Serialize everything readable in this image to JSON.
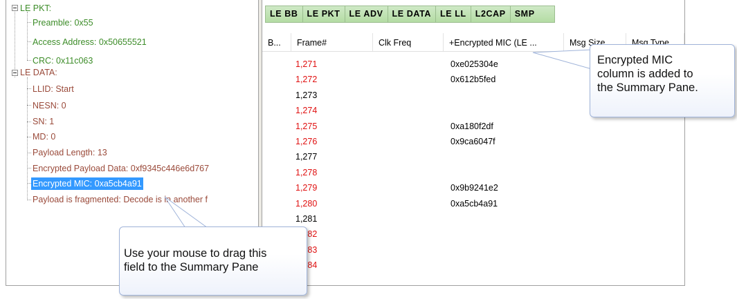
{
  "tree": {
    "le_pkt": {
      "label": "LE PKT:",
      "children": [
        "Preamble: 0x55",
        "Access Address: 0x50655521",
        "CRC: 0x11c063"
      ]
    },
    "le_data": {
      "label": "LE DATA:",
      "children": [
        "LLID: Start",
        "NESN: 0",
        "SN: 1",
        "MD: 0",
        "Payload Length: 13",
        "Encrypted Payload Data: 0xf9345c446e6d767",
        "Encrypted MIC: 0xa5cb4a91",
        "Payload is fragmented: Decode is in another f"
      ]
    }
  },
  "tabs": [
    "LE BB",
    "LE PKT",
    "LE ADV",
    "LE DATA",
    "LE LL",
    "L2CAP",
    "SMP"
  ],
  "columns": [
    "B...",
    "Frame#",
    "Clk Freq",
    "+Encrypted MIC (LE ...",
    "Msg Size",
    "Msg Type"
  ],
  "rows": [
    {
      "frame": "1,271",
      "mic": "0xe025304e",
      "color": "#e01010"
    },
    {
      "frame": "1,272",
      "mic": "0x612b5fed",
      "color": "#e01010"
    },
    {
      "frame": "1,273",
      "mic": "",
      "color": "#000000"
    },
    {
      "frame": "1,274",
      "mic": "",
      "color": "#e01010"
    },
    {
      "frame": "1,275",
      "mic": "0xa180f2df",
      "color": "#e01010"
    },
    {
      "frame": "1,276",
      "mic": "0x9ca6047f",
      "color": "#e01010"
    },
    {
      "frame": "1,277",
      "mic": "",
      "color": "#000000"
    },
    {
      "frame": "1,278",
      "mic": "",
      "color": "#e01010"
    },
    {
      "frame": "1,279",
      "mic": "0x9b9241e2",
      "color": "#e01010"
    },
    {
      "frame": "1,280",
      "mic": "0xa5cb4a91",
      "color": "#e01010"
    },
    {
      "frame": "1,281",
      "mic": "",
      "color": "#000000"
    },
    {
      "frame": "1,282",
      "mic": "",
      "color": "#e01010"
    },
    {
      "frame": "1,283",
      "mic": "",
      "color": "#e01010"
    },
    {
      "frame": "1,284",
      "mic": "",
      "color": "#e01010"
    }
  ],
  "callouts": {
    "summary_note": [
      "Encrypted MIC",
      "column is added to",
      "the Summary Pane."
    ],
    "drag_note": [
      "Use your mouse to drag this",
      "field to the Summary Pane"
    ]
  }
}
